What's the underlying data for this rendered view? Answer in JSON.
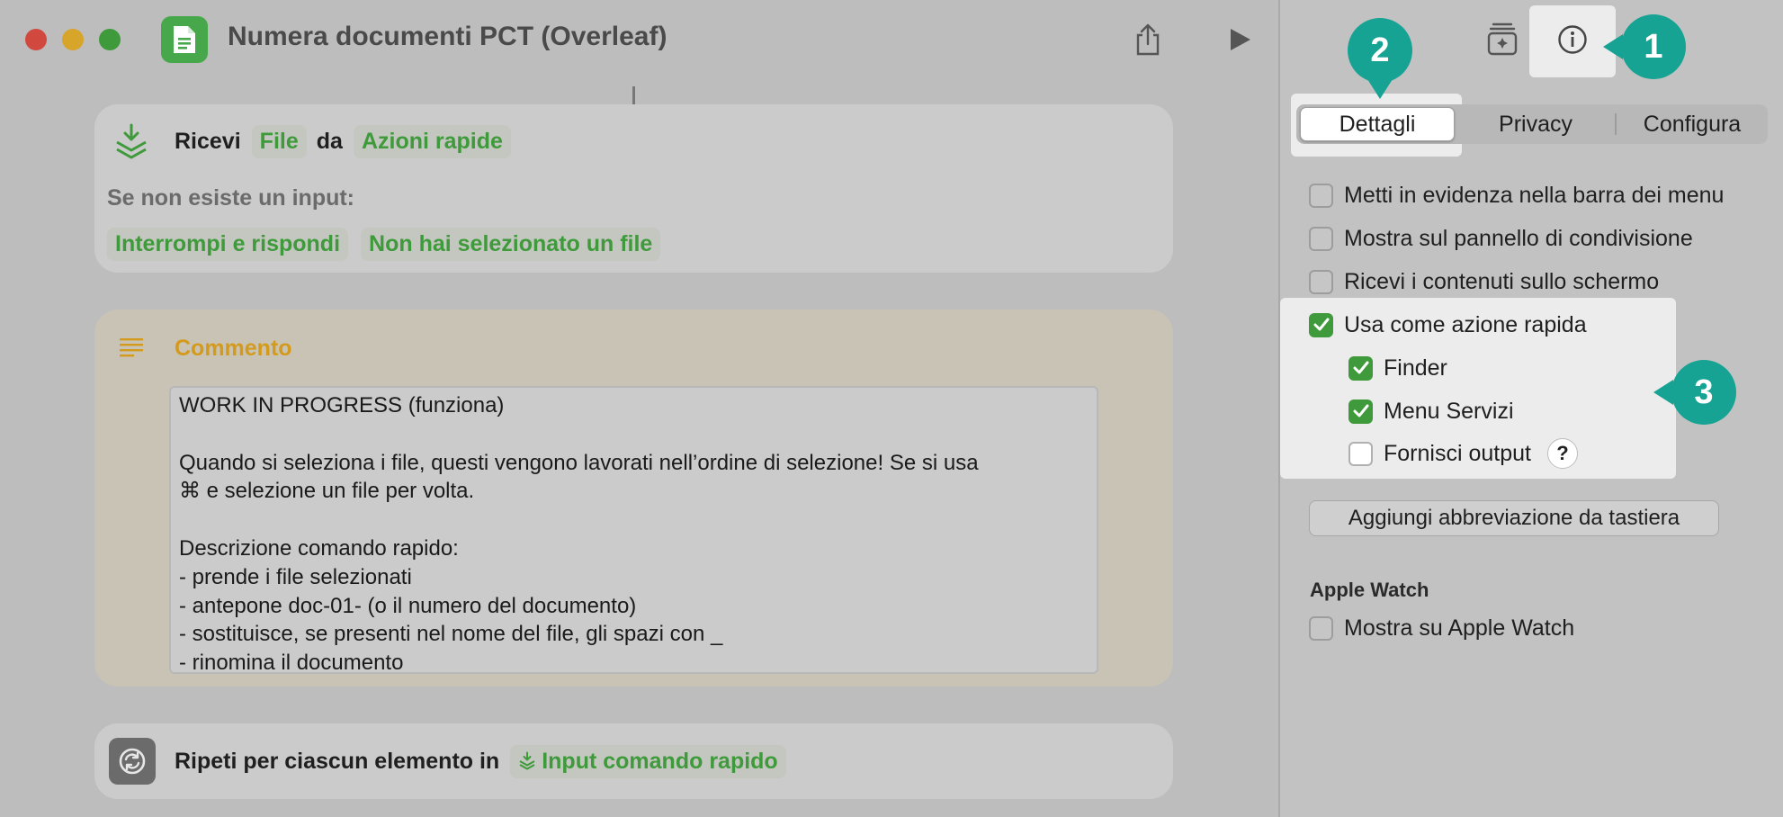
{
  "window": {
    "title": "Numera documenti PCT (Overleaf)",
    "app_icon": "shortcut-document-icon",
    "toolbar_icons": [
      "share-icon",
      "play-icon"
    ]
  },
  "receive_card": {
    "verb": "Ricevi",
    "type_token": "File",
    "from_word": "da",
    "source_token": "Azioni rapide",
    "no_input_label": "Se non esiste un input:",
    "action_token": "Interrompi e rispondi",
    "message_token": "Non hai selezionato un file"
  },
  "comment_card": {
    "title": "Commento",
    "lines": [
      "WORK IN PROGRESS (funziona)",
      "",
      "Quando si seleziona i file, questi vengono lavorati nell’ordine di selezione! Se si usa",
      "⌘ e selezione un file per volta.",
      "",
      "Descrizione comando rapido:",
      "- prende i file selezionati",
      "- antepone doc-01- (o il numero del documento)",
      "- sostituisce, se presenti nel nome del file, gli spazi con _",
      "- rinomina il documento"
    ]
  },
  "repeat_card": {
    "label": "Ripeti per ciascun elemento in",
    "token": "Input comando rapido"
  },
  "inspector": {
    "tabs": [
      "Dettagli",
      "Privacy",
      "Configura"
    ],
    "selected_tab": "Dettagli",
    "options": [
      {
        "label": "Metti in evidenza nella barra dei menu",
        "checked": false
      },
      {
        "label": "Mostra sul pannello di condivisione",
        "checked": false
      },
      {
        "label": "Ricevi i contenuti sullo schermo",
        "checked": false
      },
      {
        "label": "Usa come azione rapida",
        "checked": true
      }
    ],
    "sub_options": [
      {
        "label": "Finder",
        "checked": true
      },
      {
        "label": "Menu Servizi",
        "checked": true
      },
      {
        "label": "Fornisci output",
        "checked": false
      }
    ],
    "help_label": "?",
    "shortcut_button": "Aggiungi abbreviazione da tastiera",
    "watch_section": "Apple Watch",
    "watch_option": {
      "label": "Mostra su Apple Watch",
      "checked": false
    }
  },
  "callouts": [
    "1",
    "2",
    "3"
  ],
  "colors": {
    "accent_green": "#3e9a3a",
    "callout_teal": "#17a393",
    "comment_yellow": "#d49a1c"
  }
}
